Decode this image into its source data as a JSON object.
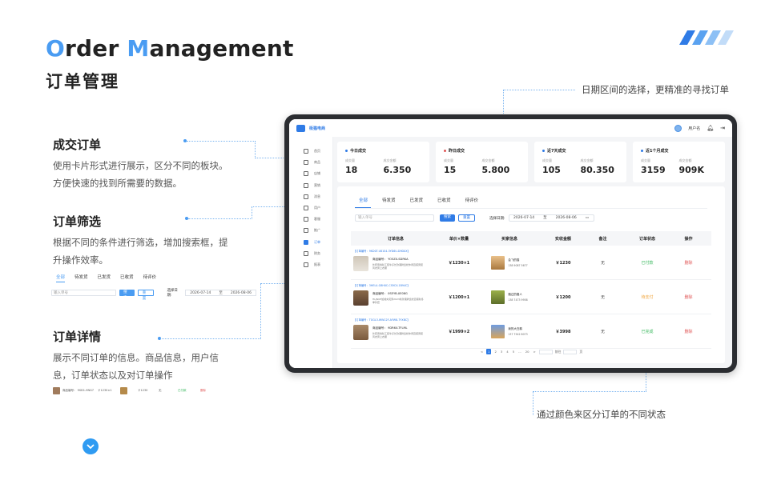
{
  "header": {
    "title_en_first": "O",
    "title_en_rest1": "rder ",
    "title_en_m": "M",
    "title_en_rest2": "anagement",
    "title_cn": "订单管理"
  },
  "sections": [
    {
      "title": "成交订单",
      "desc": "使用卡片形式进行展示，区分不同的板块。方便快速的找到所需要的数据。"
    },
    {
      "title": "订单筛选",
      "desc": "根据不同的条件进行筛选，增加搜索框，提升操作效率。"
    },
    {
      "title": "订单详情",
      "desc": "展示不同订单的信息。商品信息，用户信息，订单状态以及对订单操作"
    }
  ],
  "callouts": {
    "date_range": "日期区间的选择，更精准的寻找订单",
    "status_color": "通过颜色来区分订单的不同状态"
  },
  "app": {
    "brand": "街猫电商",
    "user_name": "用户名",
    "sidebar": [
      "首页",
      "商品",
      "店铺",
      "营销",
      "消息",
      "用户",
      "客服",
      "推广",
      "订单",
      "财务",
      "报表"
    ],
    "active_sidebar_index": 8,
    "stats": [
      {
        "title": "今日成交",
        "dot_color": "#2f7be6",
        "count_label": "成交量",
        "count": "18",
        "amount_label": "成交金额",
        "amount": "6.350"
      },
      {
        "title": "昨日成交",
        "dot_color": "#e05757",
        "count_label": "成交量",
        "count": "15",
        "amount_label": "成交金额",
        "amount": "5.800"
      },
      {
        "title": "近7天成交",
        "dot_color": "#2f7be6",
        "count_label": "成交量",
        "count": "105",
        "amount_label": "成交金额",
        "amount": "80.350"
      },
      {
        "title": "近1个月成交",
        "dot_color": "#2f7be6",
        "count_label": "成交量",
        "count": "3159",
        "amount_label": "成交金额",
        "amount": "909K"
      }
    ],
    "tabs": [
      "全部",
      "待发货",
      "已发货",
      "已收货",
      "待评价"
    ],
    "filter": {
      "search_placeholder": "输入单号",
      "search_button": "搜索",
      "reset_button": "重置",
      "date_label": "选择日期:",
      "date_start": "2026-07-14",
      "date_sep": "至",
      "date_end": "2026-08-06"
    },
    "columns": [
      "订单信息",
      "单价×数量",
      "买家信息",
      "实收金额",
      "备注",
      "订单状态",
      "操作"
    ],
    "orders": [
      {
        "order_id": "【订单编号：9KD0T-U81S4-3YD6U-D9D0X】",
        "product_code": "商品编号： YO5ZX-SDRKA",
        "product_desc": "外套男春秋工装牛仔长款潮牌宽松休闲百搭男装风衣男上衣服",
        "unit_qty": "￥1230×1",
        "buyer_name": "会飞的猫",
        "buyer_phone": "138 9087 5677",
        "received": "￥1230",
        "remark": "无",
        "status": "已付款",
        "status_color": "#3bb85f",
        "action": "删除"
      },
      {
        "order_id": "【订单编号：3HEL4-G8H0C-CS9CX-1B94C】",
        "product_code": "商品编号： 0SEYB-XE08G",
        "product_desc": "HLJNUE加绒夹克男2023新款潮牌宽松百搭秋冬季外套",
        "unit_qty": "￥1200×1",
        "buyer_name": "路过的路人",
        "buyer_phone": "138 7473 9958",
        "received": "￥1200",
        "remark": "无",
        "status": "待支付",
        "status_color": "#f0a43a",
        "action": "删除"
      },
      {
        "order_id": "【订单编号：TGGL3-WW12F-AFW8-7YXBC】",
        "product_code": "商品编号： 9DR6X-TFLML",
        "product_desc": "外套男春秋工装牛仔长款潮牌宽松休闲百搭男装风衣男上衣服",
        "unit_qty": "￥1999×2",
        "buyer_name": "我的大白鹅",
        "buyer_phone": "137 7542 8073",
        "received": "￥3998",
        "remark": "无",
        "status": "已完成",
        "status_color": "#3bb85f",
        "action": "删除"
      }
    ],
    "pagination": {
      "prev": "<",
      "pages": [
        "1",
        "2",
        "3",
        "4",
        "5",
        "...",
        "20"
      ],
      "next": ">",
      "goto_prefix": "前往",
      "goto_suffix": "页"
    }
  },
  "mini_filter": {
    "tabs": [
      "全部",
      "待发货",
      "已发货",
      "已收货",
      "待评价"
    ],
    "search_placeholder": "输入单号",
    "search_button": "搜索",
    "reset_button": "重置",
    "date_label": "选择日期:",
    "date_start": "2026-07-14",
    "date_sep": "至",
    "date_end": "2026-08-06"
  },
  "mini_detail": {
    "code": "商品编号： 9SD1-9NG7",
    "price": "￥1230×1",
    "amount": "￥1230",
    "remark": "无",
    "status": "已付款",
    "action": "删除"
  }
}
